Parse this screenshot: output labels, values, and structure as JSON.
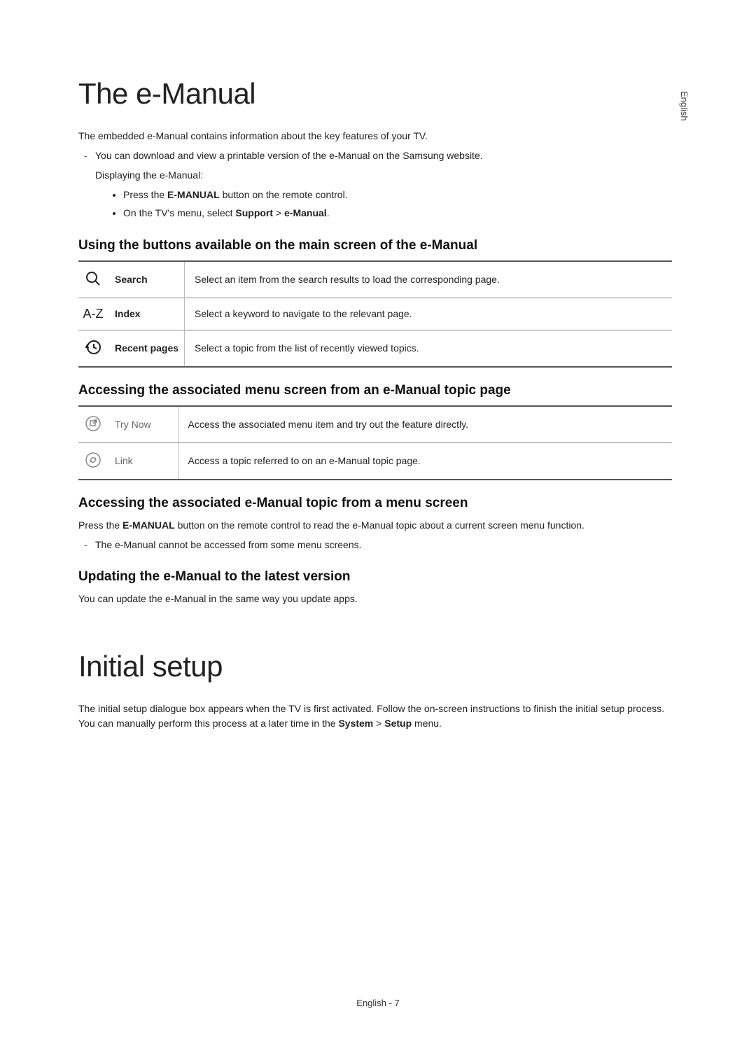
{
  "side_language": "English",
  "section1": {
    "title": "The e-Manual",
    "intro": "The embedded e-Manual contains information about the key features of your TV.",
    "dash1": "You can download and view a printable version of the e-Manual on the Samsung website.",
    "displaying": "Displaying the e-Manual:",
    "bullet1_pre": "Press the ",
    "bullet1_bold": "E-MANUAL",
    "bullet1_post": " button on the remote control.",
    "bullet2_pre": "On the TV's menu, select ",
    "bullet2_b1": "Support",
    "bullet2_mid": " > ",
    "bullet2_b2": "e-Manual",
    "bullet2_post": ".",
    "h2_buttons": "Using the buttons available on the main screen of the e-Manual",
    "table1": {
      "row1": {
        "label": "Search",
        "desc": "Select an item from the search results to load the corresponding page."
      },
      "row2": {
        "label": "Index",
        "desc": "Select a keyword to navigate to the relevant page."
      },
      "row3": {
        "label": "Recent pages",
        "desc": "Select a topic from the list of recently viewed topics."
      }
    },
    "h2_access_topic": "Accessing the associated menu screen from an e-Manual topic page",
    "table2": {
      "row1": {
        "label": "Try Now",
        "desc": "Access the associated menu item and try out the feature directly."
      },
      "row2": {
        "label": "Link",
        "desc": "Access a topic referred to on an e-Manual topic page."
      }
    },
    "h2_access_menu": "Accessing the associated e-Manual topic from a menu screen",
    "access_menu_pre": "Press the ",
    "access_menu_bold": "E-MANUAL",
    "access_menu_post": " button on the remote control to read the e-Manual topic about a current screen menu function.",
    "access_menu_note": "The e-Manual cannot be accessed from some menu screens.",
    "h2_update": "Updating the e-Manual to the latest version",
    "update_text": "You can update the e-Manual in the same way you update apps."
  },
  "section2": {
    "title": "Initial setup",
    "text_pre": "The initial setup dialogue box appears when the TV is first activated. Follow the on-screen instructions to finish the initial setup process. You can manually perform this process at a later time in the ",
    "text_b1": "System",
    "text_mid": " > ",
    "text_b2": "Setup",
    "text_post": " menu."
  },
  "footer": "English - 7",
  "icons": {
    "az": "A-Z"
  }
}
